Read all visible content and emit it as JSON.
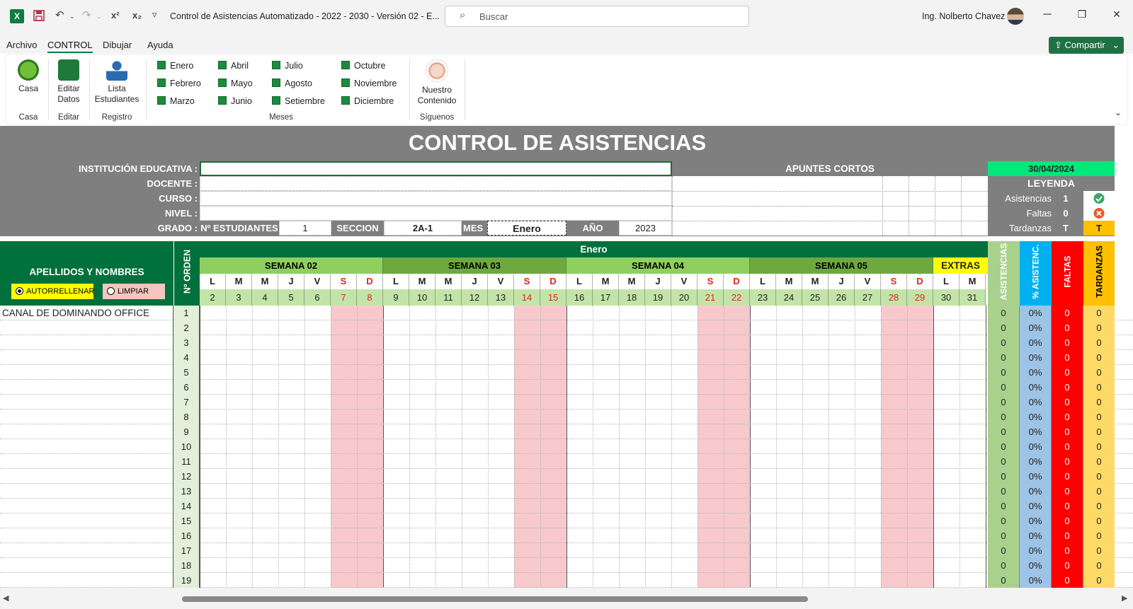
{
  "window": {
    "app_icon": "X",
    "title": "Control de Asistencias Automatizado - 2022 - 2030 - Versión 02  -  E...",
    "search_placeholder": "Buscar",
    "user": "Ing. Nolberto Chavez",
    "qa_undo": "↶",
    "qa_redo": "↷",
    "qa_superscript": "x²",
    "qa_subscript": "x₂",
    "qa_more": "▿",
    "min": "─",
    "max": "❐",
    "close": "✕"
  },
  "tabs": [
    "Archivo",
    "CONTROL",
    "Dibujar",
    "Ayuda"
  ],
  "share_label": "Compartir",
  "ribbon": {
    "casa": {
      "label": "Casa",
      "group": "Casa"
    },
    "editar": {
      "label1": "Editar",
      "label2": "Datos",
      "group": "Editar"
    },
    "lista": {
      "label1": "Lista",
      "label2": "Estudiantes",
      "group": "Registro"
    },
    "months": [
      "Enero",
      "Febrero",
      "Marzo",
      "Abril",
      "Mayo",
      "Junio",
      "Julio",
      "Agosto",
      "Setiembre",
      "Octubre",
      "Noviembre",
      "Diciembre"
    ],
    "meses_group": "Meses",
    "nuestro": {
      "label1": "Nuestro",
      "label2": "Contenido",
      "group": "Síguenos"
    }
  },
  "sheet": {
    "title": "CONTROL DE ASISTENCIAS",
    "labels": {
      "institucion": "INSTITUCIÓN EDUCATIVA :",
      "docente": "DOCENTE :",
      "curso": "CURSO :",
      "nivel": "NIVEL :",
      "grado": "GRADO :"
    },
    "apuntes": "APUNTES CORTOS",
    "fecha": "30/04/2024",
    "leyenda": {
      "title": "LEYENDA",
      "asistencias": "Asistencias",
      "asistencias_val": "1",
      "faltas": "Faltas",
      "faltas_val": "0",
      "tardanzas": "Tardanzas",
      "tardanzas_val": "T",
      "t_badge": "T"
    },
    "n_estudiantes_label": "Nº ESTUDIANTES",
    "n_estudiantes": "1",
    "seccion_label": "SECCION",
    "seccion": "2A-1",
    "mes_label": "MES",
    "mes": "Enero",
    "anio_label": "AÑO",
    "anio": "2023",
    "apellidos": "APELLIDOS Y NOMBRES",
    "autorrellenar": "AUTORRELLENAR",
    "limpiar": "LIMPIAR",
    "n_orden": "Nº ORDEN",
    "month_header": "Enero",
    "weeks": [
      "SEMANA 02",
      "SEMANA 03",
      "SEMANA 04",
      "SEMANA 05"
    ],
    "extras": "EXTRAS",
    "day_letters": [
      "L",
      "M",
      "M",
      "J",
      "V",
      "S",
      "D",
      "L",
      "M",
      "M",
      "J",
      "V",
      "S",
      "D",
      "L",
      "M",
      "M",
      "J",
      "V",
      "S",
      "D",
      "L",
      "M",
      "M",
      "J",
      "V",
      "S",
      "D",
      "L",
      "M"
    ],
    "day_numbers": [
      "2",
      "3",
      "4",
      "5",
      "6",
      "7",
      "8",
      "9",
      "10",
      "11",
      "12",
      "13",
      "14",
      "15",
      "16",
      "17",
      "18",
      "19",
      "20",
      "21",
      "22",
      "23",
      "24",
      "25",
      "26",
      "27",
      "28",
      "29",
      "30",
      "31"
    ],
    "summary_headers": [
      "ASISTENCIAS",
      "% ASISTENC.",
      "FALTAS",
      "TARDANZAS"
    ],
    "rows": [
      {
        "n": "1",
        "name": "CANAL DE DOMINANDO OFFICE",
        "a": "0",
        "p": "0%",
        "f": "0",
        "t": "0"
      },
      {
        "n": "2",
        "name": "",
        "a": "0",
        "p": "0%",
        "f": "0",
        "t": "0"
      },
      {
        "n": "3",
        "name": "",
        "a": "0",
        "p": "0%",
        "f": "0",
        "t": "0"
      },
      {
        "n": "4",
        "name": "",
        "a": "0",
        "p": "0%",
        "f": "0",
        "t": "0"
      },
      {
        "n": "5",
        "name": "",
        "a": "0",
        "p": "0%",
        "f": "0",
        "t": "0"
      },
      {
        "n": "6",
        "name": "",
        "a": "0",
        "p": "0%",
        "f": "0",
        "t": "0"
      },
      {
        "n": "7",
        "name": "",
        "a": "0",
        "p": "0%",
        "f": "0",
        "t": "0"
      },
      {
        "n": "8",
        "name": "",
        "a": "0",
        "p": "0%",
        "f": "0",
        "t": "0"
      },
      {
        "n": "9",
        "name": "",
        "a": "0",
        "p": "0%",
        "f": "0",
        "t": "0"
      },
      {
        "n": "10",
        "name": "",
        "a": "0",
        "p": "0%",
        "f": "0",
        "t": "0"
      },
      {
        "n": "11",
        "name": "",
        "a": "0",
        "p": "0%",
        "f": "0",
        "t": "0"
      },
      {
        "n": "12",
        "name": "",
        "a": "0",
        "p": "0%",
        "f": "0",
        "t": "0"
      },
      {
        "n": "13",
        "name": "",
        "a": "0",
        "p": "0%",
        "f": "0",
        "t": "0"
      },
      {
        "n": "14",
        "name": "",
        "a": "0",
        "p": "0%",
        "f": "0",
        "t": "0"
      },
      {
        "n": "15",
        "name": "",
        "a": "0",
        "p": "0%",
        "f": "0",
        "t": "0"
      },
      {
        "n": "16",
        "name": "",
        "a": "0",
        "p": "0%",
        "f": "0",
        "t": "0"
      },
      {
        "n": "17",
        "name": "",
        "a": "0",
        "p": "0%",
        "f": "0",
        "t": "0"
      },
      {
        "n": "18",
        "name": "",
        "a": "0",
        "p": "0%",
        "f": "0",
        "t": "0"
      },
      {
        "n": "19",
        "name": "",
        "a": "0",
        "p": "0%",
        "f": "0",
        "t": "0"
      }
    ]
  },
  "colors": {
    "excel_green": "#107c41",
    "header_gray": "#7f7f7f",
    "week_green": "#8fcf5f",
    "weekend_pink": "#f7c9cc",
    "asistencias_green": "#a9d18e",
    "pct_blue": "#9dc3e6",
    "faltas_red": "#ff0000",
    "tardanzas_yellow": "#ffd966"
  },
  "icons": [
    "excel-icon",
    "save-icon",
    "undo-icon",
    "redo-icon",
    "search-icon",
    "home-icon",
    "excel-edit-icon",
    "student-icon",
    "sheet-month-icon",
    "hand-icon",
    "check-icon",
    "cross-icon",
    "share-icon",
    "chevron-down-icon"
  ]
}
